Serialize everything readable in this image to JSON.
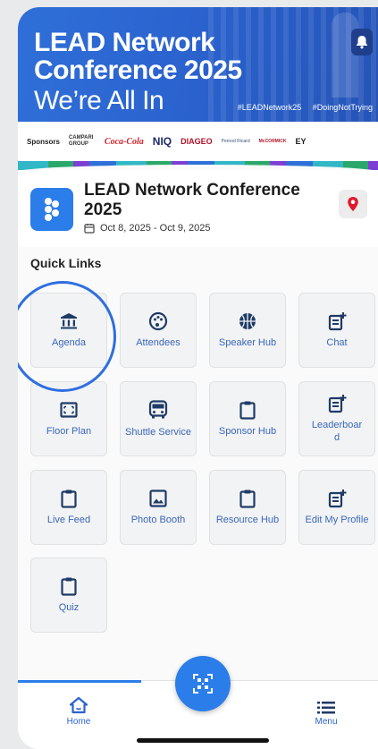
{
  "banner": {
    "title": "LEAD Network\nConference 2025",
    "tagline": "We’re All In",
    "hashtags": [
      "#LEADNetwork25",
      "#DoingNotTrying"
    ]
  },
  "sponsors": {
    "label": "Sponsors",
    "items": [
      "CAMPARI GROUP",
      "Coca-Cola",
      "NIQ",
      "DIAGEO",
      "Pernod Ricard",
      "McCORMICK",
      "EY"
    ]
  },
  "event": {
    "title": "LEAD Network Conference 2025",
    "dates": "Oct 8, 2025 - Oct 9, 2025"
  },
  "quick_links": {
    "label": "Quick Links",
    "items": [
      {
        "label": "Agenda",
        "icon": "bank-icon"
      },
      {
        "label": "Attendees",
        "icon": "palette-icon"
      },
      {
        "label": "Speaker Hub",
        "icon": "basketball-icon"
      },
      {
        "label": "Chat",
        "icon": "notepad-plus-icon"
      },
      {
        "label": "Floor Plan",
        "icon": "floor-plan-icon"
      },
      {
        "label": "Shuttle Service",
        "icon": "bus-icon"
      },
      {
        "label": "Sponsor Hub",
        "icon": "clipboard-icon"
      },
      {
        "label": "Leaderboard",
        "icon": "notepad-plus-icon"
      },
      {
        "label": "Live Feed",
        "icon": "clipboard-icon"
      },
      {
        "label": "Photo Booth",
        "icon": "image-icon"
      },
      {
        "label": "Resource Hub",
        "icon": "clipboard-icon"
      },
      {
        "label": "Edit My Profile",
        "icon": "notepad-plus-icon"
      },
      {
        "label": "Quiz",
        "icon": "clipboard-icon"
      }
    ]
  },
  "nav": {
    "home": "Home",
    "menu": "Menu"
  },
  "colors": {
    "accent": "#2b7de9",
    "banner": "#2f6fd8",
    "tile_text": "#3a67b7",
    "pin": "#e0192d"
  }
}
